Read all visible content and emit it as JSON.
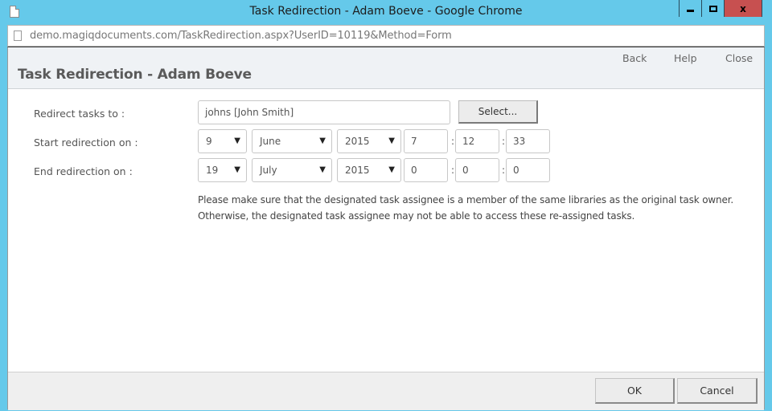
{
  "window": {
    "title": "Task Redirection - Adam Boeve - Google Chrome",
    "controls": {
      "minimize": "minimize",
      "maximize": "maximize",
      "close": "x"
    }
  },
  "address_bar": {
    "url": "demo.magiqdocuments.com/TaskRedirection.aspx?UserID=10119&Method=Form"
  },
  "header": {
    "title": "Task Redirection - Adam Boeve",
    "nav": {
      "back": "Back",
      "help": "Help",
      "close": "Close"
    }
  },
  "form": {
    "redirect": {
      "label": "Redirect tasks to :",
      "value": "johns [John Smith]",
      "select_button": "Select..."
    },
    "start": {
      "label": "Start redirection on :",
      "day": "9",
      "month": "June",
      "year": "2015",
      "hour": "7",
      "minute": "12",
      "second": "33"
    },
    "end": {
      "label": "End redirection on :",
      "day": "19",
      "month": "July",
      "year": "2015",
      "hour": "0",
      "minute": "0",
      "second": "0"
    },
    "separator": ":",
    "dropdown_arrow": "▼",
    "notice_line1": "Please make sure that the designated task assignee is a member of the same libraries as the original task owner.",
    "notice_line2": "Otherwise, the designated task assignee may not be able to access these re-assigned tasks."
  },
  "footer": {
    "ok": "OK",
    "cancel": "Cancel"
  },
  "colors": {
    "window_frame": "#65c9ea",
    "close_button": "#c75050",
    "header_bg": "#eff2f5",
    "footer_bg": "#efefef"
  }
}
